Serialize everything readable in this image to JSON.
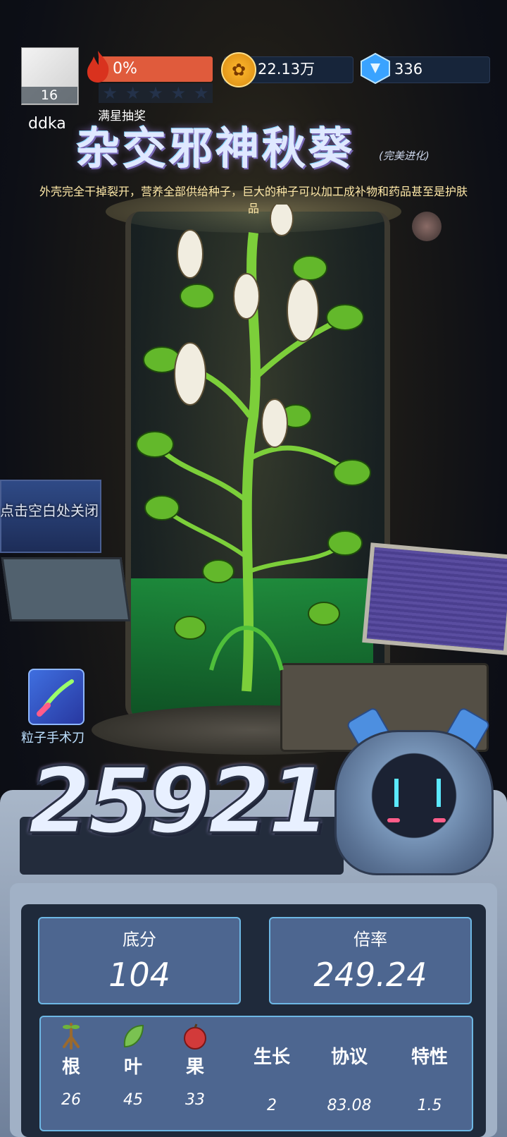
{
  "player": {
    "avatar_level": "16",
    "username": "ddka"
  },
  "hud": {
    "fire_percent": "0%",
    "coins": "22.13万",
    "gems": "336",
    "star_count": 5
  },
  "plant": {
    "event_label": "满星抽奖",
    "name": "杂交邪神秋葵",
    "evolution_tag": "(完美进化)",
    "description": "外壳完全干掉裂开，营养全部供给种子，巨大的种子可以加工成补物和药品甚至是护肤品"
  },
  "scene": {
    "close_hint": "点击空白处关闭",
    "tool_label": "粒子手术刀"
  },
  "score": {
    "total": "25921",
    "base_label": "底分",
    "base_value": "104",
    "multiplier_label": "倍率",
    "multiplier_value": "249.24"
  },
  "attributes": [
    {
      "label": "根",
      "icon": "root-icon",
      "value": "26"
    },
    {
      "label": "叶",
      "icon": "leaf-icon",
      "value": "45"
    },
    {
      "label": "果",
      "icon": "fruit-icon",
      "value": "33"
    },
    {
      "label": "生长",
      "icon": "",
      "value": "2"
    },
    {
      "label": "协议",
      "icon": "",
      "value": "83.08"
    },
    {
      "label": "特性",
      "icon": "",
      "value": "1.5"
    }
  ],
  "colors": {
    "fire_bar": "#e05b3c",
    "stat_card": "#4d6690",
    "stat_border": "#6db7e4",
    "liquid": "#1d9a3f"
  }
}
